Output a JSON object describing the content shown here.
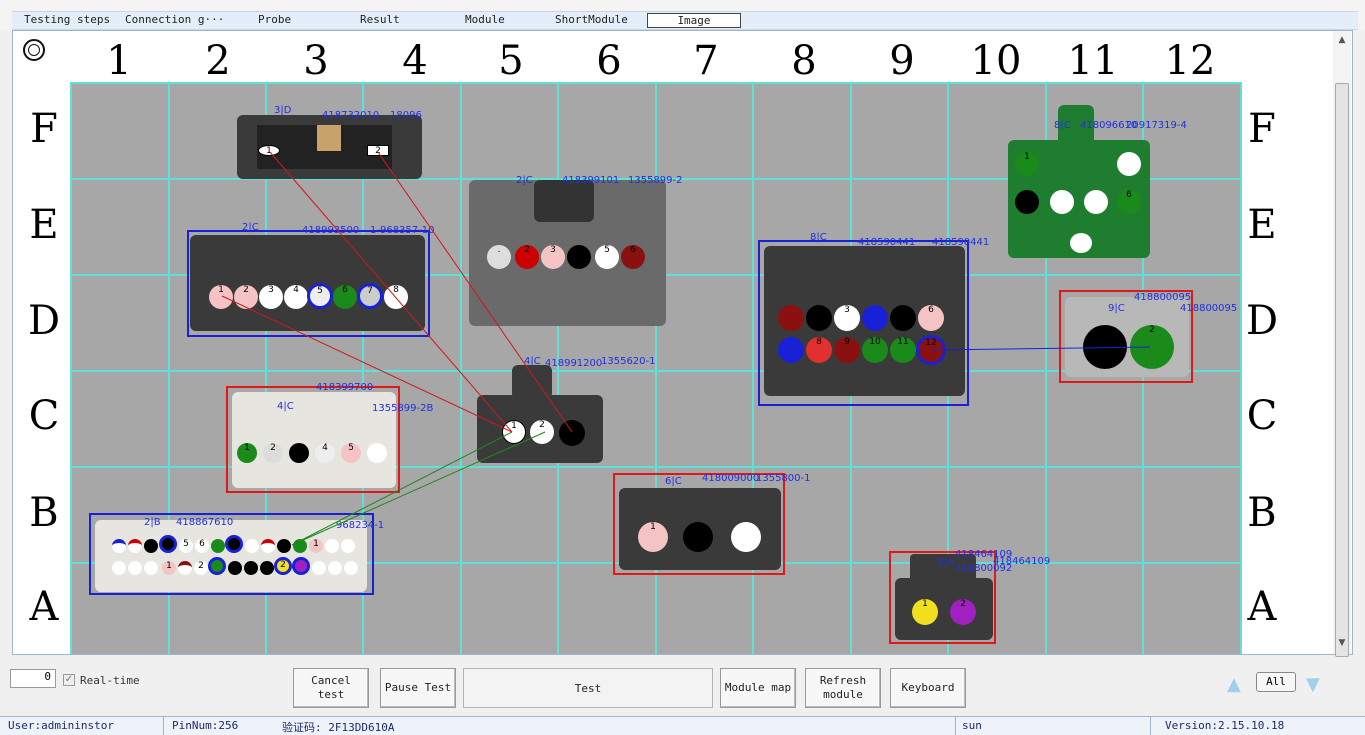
{
  "tabs": [
    "Testing steps",
    "Connection g···",
    "Probe",
    "Result",
    "Module",
    "ShortModule",
    "Image"
  ],
  "active_tab": "Image",
  "grid": {
    "columns": [
      "1",
      "2",
      "3",
      "4",
      "5",
      "6",
      "7",
      "8",
      "9",
      "10",
      "11",
      "12"
    ],
    "rows": [
      "F",
      "E",
      "D",
      "C",
      "B",
      "A"
    ]
  },
  "connectors": {
    "c1": {
      "label": "3|D",
      "part": "418732010",
      "ref": "18096"
    },
    "c2": {
      "label": "2|C",
      "part": "418399101",
      "ref": "1355899-2"
    },
    "c3": {
      "label": "2|C",
      "part": "418993500",
      "ref": "1-968357-10"
    },
    "c4": {
      "label": "8|C",
      "part": "418590441",
      "ref": "418590441"
    },
    "c5": {
      "label": "8|C",
      "part": "418096610",
      "ref": "20917319-4"
    },
    "c6": {
      "label": "9|C",
      "part": "418800095",
      "ref": "418800095"
    },
    "c7": {
      "label": "4|C",
      "part": "418399700",
      "ref": "1355899-2B"
    },
    "c8": {
      "label": "4|C",
      "part": "418991200",
      "ref": "1355620-1"
    },
    "c9": {
      "label": "6|C",
      "part": "418009000",
      "ref": "1355800-1"
    },
    "c10": {
      "label": "2|B",
      "part": "418867610",
      "ref": "968234-1"
    },
    "c11": {
      "label": "9|A",
      "part": "418464109",
      "ref": "418464109",
      "ref2": "418800092"
    }
  },
  "buttons": {
    "cancel": "Cancel\ntest",
    "pause": "Pause Test",
    "test": "Test",
    "module_map": "Module map",
    "refresh": "Refresh\nmodule",
    "keyboard": "Keyboard",
    "all": "All"
  },
  "counter_value": "0",
  "realtime_label": "Real-time",
  "status": {
    "user": "User:admininstor",
    "pinnum": "PinNum:256",
    "code": "验证码: 2F13DD610A",
    "name": "sun",
    "version": "Version:2.15.10.18"
  }
}
